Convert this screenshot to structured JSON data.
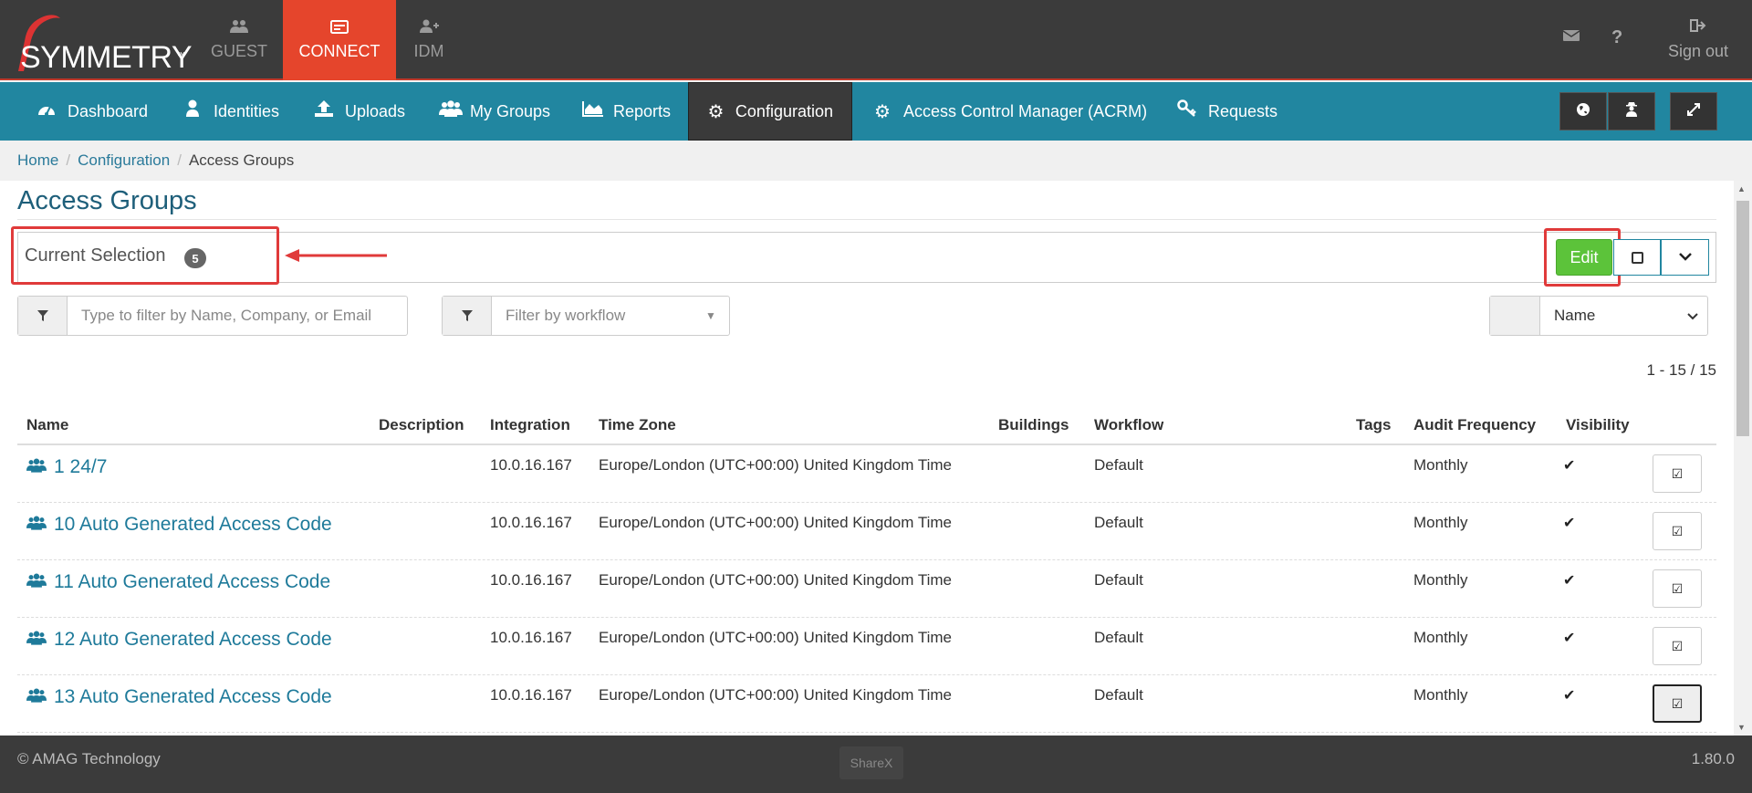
{
  "app": {
    "logo_text": "SYMMETRY",
    "logo_tm": "™",
    "tabs": [
      {
        "label": "GUEST",
        "icon": "users-icon"
      },
      {
        "label": "CONNECT",
        "icon": "id-card-icon"
      },
      {
        "label": "IDM",
        "icon": "user-plus-icon"
      }
    ],
    "signout_label": "Sign out"
  },
  "nav": {
    "items": [
      {
        "label": "Dashboard",
        "icon": "dashboard-icon"
      },
      {
        "label": "Identities",
        "icon": "user-icon"
      },
      {
        "label": "Uploads",
        "icon": "upload-icon"
      },
      {
        "label": "My Groups",
        "icon": "group-icon"
      },
      {
        "label": "Reports",
        "icon": "area-chart-icon"
      },
      {
        "label": "Configuration",
        "icon": "gear-icon"
      },
      {
        "label": "Access Control Manager (ACRM)",
        "icon": "gear-icon"
      },
      {
        "label": "Requests",
        "icon": "key-icon"
      }
    ]
  },
  "breadcrumb": {
    "home": "Home",
    "configuration": "Configuration",
    "current": "Access Groups",
    "sep": "/"
  },
  "page": {
    "title": "Access Groups",
    "selection_label": "Current Selection",
    "selection_count": "5",
    "edit_label": "Edit",
    "filter_name_placeholder": "Type to filter by Name, Company, or Email",
    "filter_workflow_placeholder": "Filter by workflow",
    "sort_value": "Name",
    "pager": "1 - 15 / 15"
  },
  "table": {
    "headers": {
      "name": "Name",
      "description": "Description",
      "integration": "Integration",
      "time_zone": "Time Zone",
      "buildings": "Buildings",
      "workflow": "Workflow",
      "tags": "Tags",
      "audit_frequency": "Audit Frequency",
      "visibility": "Visibility"
    },
    "rows": [
      {
        "name": "1 24/7",
        "integration": "10.0.16.167",
        "time_zone": "Europe/London (UTC+00:00) United Kingdom Time",
        "workflow": "Default",
        "audit": "Monthly",
        "visibility": "✔"
      },
      {
        "name": "10 Auto Generated Access Code",
        "integration": "10.0.16.167",
        "time_zone": "Europe/London (UTC+00:00) United Kingdom Time",
        "workflow": "Default",
        "audit": "Monthly",
        "visibility": "✔"
      },
      {
        "name": "11 Auto Generated Access Code",
        "integration": "10.0.16.167",
        "time_zone": "Europe/London (UTC+00:00) United Kingdom Time",
        "workflow": "Default",
        "audit": "Monthly",
        "visibility": "✔"
      },
      {
        "name": "12 Auto Generated Access Code",
        "integration": "10.0.16.167",
        "time_zone": "Europe/London (UTC+00:00) United Kingdom Time",
        "workflow": "Default",
        "audit": "Monthly",
        "visibility": "✔"
      },
      {
        "name": "13 Auto Generated Access Code",
        "integration": "10.0.16.167",
        "time_zone": "Europe/London (UTC+00:00) United Kingdom Time",
        "workflow": "Default",
        "audit": "Monthly",
        "visibility": "✔"
      }
    ]
  },
  "footer": {
    "copyright": "© AMAG Technology",
    "center": "ShareX",
    "version": "1.80.0"
  },
  "colors": {
    "accent_red": "#e5452c",
    "nav_teal": "#2186a0",
    "edit_green": "#5cc33a",
    "link_blue": "#1e7a9a",
    "annotation_red": "#e03a3a"
  }
}
